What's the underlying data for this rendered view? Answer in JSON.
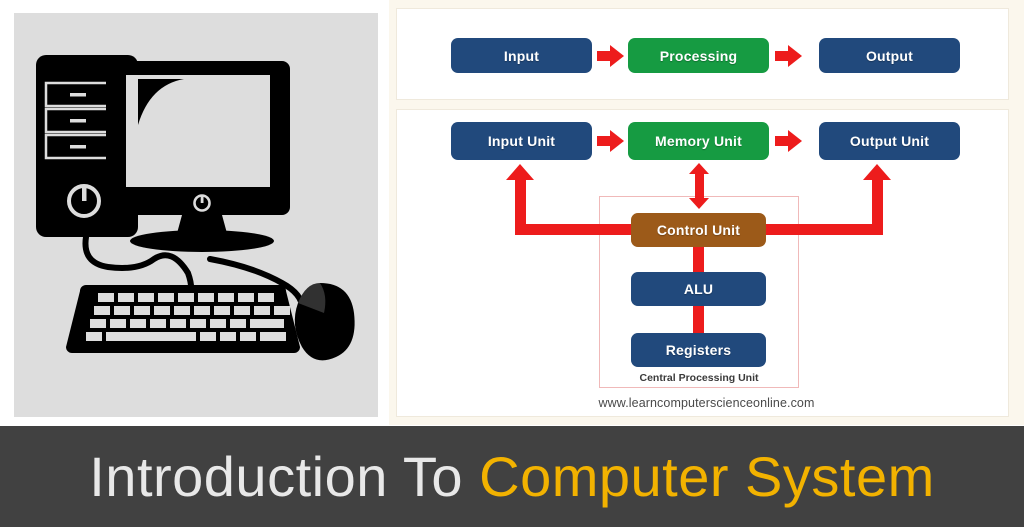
{
  "page": {
    "title_leading": "Introduction To",
    "title_highlight": "Computer System",
    "title_highlight_color": "#f2b200",
    "title_leading_color": "#e8e8e8",
    "title_bar_color": "#414141",
    "background_color": "#ffffff"
  },
  "illustration": {
    "name": "desktop-computer-icon",
    "panel_background": "#dddddd",
    "ink_color": "#000000",
    "parts": [
      "tower-case",
      "drive-bay-1",
      "drive-bay-2",
      "drive-bay-3",
      "tower-power-button",
      "monitor",
      "monitor-screen",
      "monitor-stand",
      "monitor-power-button",
      "keyboard",
      "mouse",
      "cables"
    ]
  },
  "diagram": {
    "background_color": "#fbf7ed",
    "panel_color": "#ffffff",
    "arrow_color": "#ed1c1c",
    "colors": {
      "blue": "#21497c",
      "green": "#169b42",
      "brown": "#9c5a19",
      "cpu_outline": "#f0b9b9"
    },
    "watermark": "www.learncomputerscienceonline.com",
    "top_row": {
      "nodes": [
        {
          "label": "Input",
          "color": "blue"
        },
        {
          "label": "Processing",
          "color": "green"
        },
        {
          "label": "Output",
          "color": "blue"
        }
      ],
      "connectors": [
        "arrow-right",
        "arrow-right"
      ]
    },
    "bottom_row": {
      "nodes": [
        {
          "label": "Input Unit",
          "color": "blue"
        },
        {
          "label": "Memory Unit",
          "color": "green"
        },
        {
          "label": "Output Unit",
          "color": "blue"
        }
      ],
      "connectors": [
        "arrow-right",
        "arrow-right"
      ]
    },
    "cpu": {
      "group_label": "Central Processing  Unit",
      "nodes": [
        {
          "label": "Control Unit",
          "color": "brown"
        },
        {
          "label": "ALU",
          "color": "blue"
        },
        {
          "label": "Registers",
          "color": "blue"
        }
      ],
      "links": [
        "memory-unit-to-control-unit-bidirectional",
        "control-unit-to-alu",
        "alu-to-registers",
        "control-bus-to-input-unit",
        "control-bus-to-output-unit"
      ]
    }
  }
}
